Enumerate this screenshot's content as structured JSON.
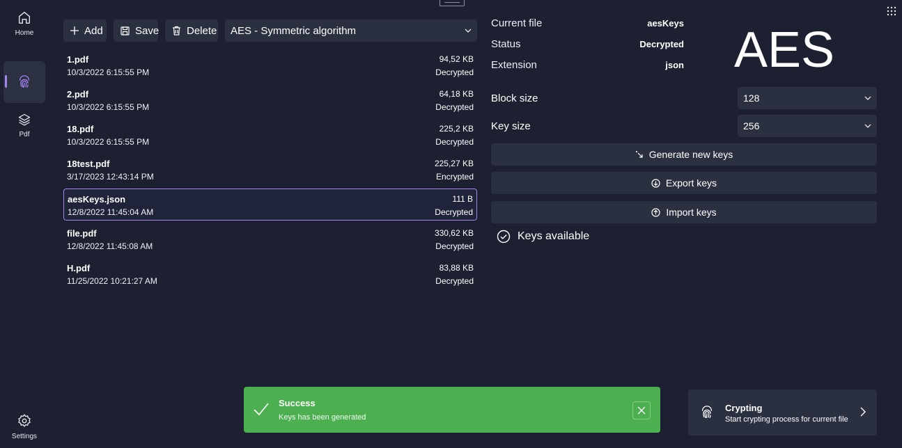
{
  "nav": {
    "home_label": "Home",
    "pdf_label": "Pdf",
    "settings_label": "Settings",
    "accent": "#a483f0"
  },
  "toolbar": {
    "add_label": "Add",
    "save_label": "Save",
    "delete_label": "Delete",
    "algorithm": "AES - Symmetric algorithm"
  },
  "files": [
    {
      "name": "1.pdf",
      "date": "10/3/2022 6:15:55 PM",
      "size": "94,52 KB",
      "status": "Decrypted"
    },
    {
      "name": "2.pdf",
      "date": "10/3/2022 6:15:55 PM",
      "size": "64,18 KB",
      "status": "Decrypted"
    },
    {
      "name": "18.pdf",
      "date": "10/3/2022 6:15:55 PM",
      "size": "225,2 KB",
      "status": "Decrypted"
    },
    {
      "name": "18test.pdf",
      "date": "3/17/2023 12:43:14 PM",
      "size": "225,27 KB",
      "status": "Encrypted"
    },
    {
      "name": "aesKeys.json",
      "date": "12/8/2022 11:45:04 AM",
      "size": "111 B",
      "status": "Decrypted"
    },
    {
      "name": "file.pdf",
      "date": "12/8/2022 11:45:08 AM",
      "size": "330,62 KB",
      "status": "Decrypted"
    },
    {
      "name": "H.pdf",
      "date": "11/25/2022 10:21:27 AM",
      "size": "83,88 KB",
      "status": "Decrypted"
    }
  ],
  "selected_file_index": 4,
  "info": {
    "current_file_label": "Current file",
    "current_file_value": "aesKeys",
    "status_label": "Status",
    "status_value": "Decrypted",
    "extension_label": "Extension",
    "extension_value": "json",
    "algorithm_big": "AES"
  },
  "options": {
    "block_size_label": "Block size",
    "block_size_value": "128",
    "key_size_label": "Key size",
    "key_size_value": "256"
  },
  "actions": {
    "generate_label": "Generate new keys",
    "export_label": "Export keys",
    "import_label": "Import keys"
  },
  "keys_status": "Keys available",
  "toast": {
    "title": "Success",
    "message": "Keys has been generated",
    "color": "#4caf50"
  },
  "crypting": {
    "title": "Crypting",
    "description": "Start crypting process for current file"
  }
}
